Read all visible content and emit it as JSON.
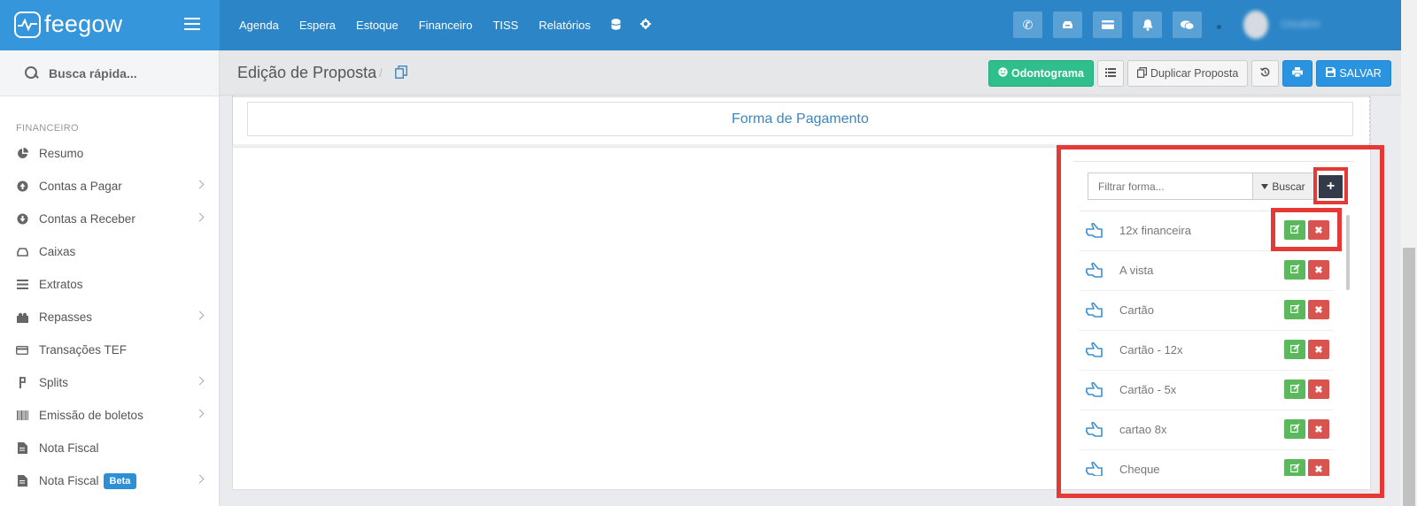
{
  "app": {
    "brand": "feegow"
  },
  "nav": {
    "items": [
      "Agenda",
      "Espera",
      "Estoque",
      "Financeiro",
      "TISS",
      "Relatórios"
    ]
  },
  "top_icons": [
    "phone-icon",
    "inbox-icon",
    "card-icon",
    "bell-icon",
    "chat-icon"
  ],
  "user": {
    "name": "Usuário"
  },
  "sidebar": {
    "search_placeholder": "Busca rápida...",
    "section": "FINANCEIRO",
    "items": [
      {
        "label": "Resumo",
        "icon": "pie-chart-icon",
        "chevron": false
      },
      {
        "label": "Contas a Pagar",
        "icon": "arrow-up-circle-icon",
        "chevron": true
      },
      {
        "label": "Contas a Receber",
        "icon": "arrow-down-circle-icon",
        "chevron": true
      },
      {
        "label": "Caixas",
        "icon": "inbox-icon",
        "chevron": false
      },
      {
        "label": "Extratos",
        "icon": "list-icon",
        "chevron": false
      },
      {
        "label": "Repasses",
        "icon": "puzzle-icon",
        "chevron": true
      },
      {
        "label": "Transações TEF",
        "icon": "credit-card-icon",
        "chevron": false
      },
      {
        "label": "Splits",
        "icon": "split-icon",
        "chevron": true
      },
      {
        "label": "Emissão de boletos",
        "icon": "barcode-icon",
        "chevron": true
      },
      {
        "label": "Nota Fiscal",
        "icon": "document-icon",
        "chevron": false
      },
      {
        "label": "Nota Fiscal",
        "icon": "document-icon",
        "chevron": true,
        "badge": "Beta"
      }
    ]
  },
  "header": {
    "title": "Edição de Proposta",
    "separator": "/",
    "buttons": {
      "odontograma": "Odontograma",
      "duplicar": "Duplicar Proposta",
      "salvar": "SALVAR"
    }
  },
  "section_title": "Forma de Pagamento",
  "payment_list": {
    "filter_placeholder": "Filtrar forma...",
    "search_label": "Buscar",
    "add_label": "+",
    "items": [
      "12x financeira",
      "A vista",
      "Cartão",
      "Cartão - 12x",
      "Cartão - 5x",
      "cartao 8x",
      "Cheque"
    ]
  },
  "colors": {
    "topbar": "#2b85c7",
    "brand": "#3596db",
    "edit": "#5cb85c",
    "delete": "#d9534f",
    "annotation": "#e53935"
  }
}
